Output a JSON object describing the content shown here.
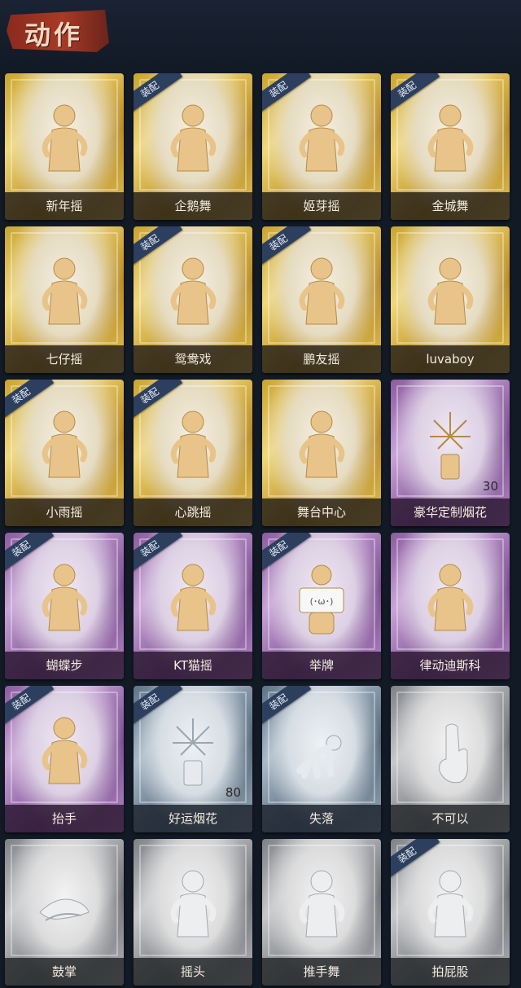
{
  "title": "动作",
  "equip_label": "装配",
  "cards": [
    {
      "name": "新年摇",
      "tier": "gold",
      "equipped": false,
      "count": "",
      "icon": "dancer-icon"
    },
    {
      "name": "企鹅舞",
      "tier": "gold",
      "equipped": true,
      "count": "",
      "icon": "dancer-icon"
    },
    {
      "name": "姬芽摇",
      "tier": "gold",
      "equipped": true,
      "count": "",
      "icon": "dancer-icon"
    },
    {
      "name": "金城舞",
      "tier": "gold",
      "equipped": true,
      "count": "",
      "icon": "dancer-icon"
    },
    {
      "name": "七仔摇",
      "tier": "gold",
      "equipped": false,
      "count": "",
      "icon": "dancer-icon"
    },
    {
      "name": "鸳鸯戏",
      "tier": "gold",
      "equipped": true,
      "count": "",
      "icon": "dancer-icon"
    },
    {
      "name": "鹏友摇",
      "tier": "gold",
      "equipped": true,
      "count": "",
      "icon": "dancer-icon"
    },
    {
      "name": "luvaboy",
      "tier": "gold",
      "equipped": false,
      "count": "",
      "icon": "dancer-icon"
    },
    {
      "name": "小雨摇",
      "tier": "gold",
      "equipped": true,
      "count": "",
      "icon": "dancer-icon"
    },
    {
      "name": "心跳摇",
      "tier": "gold",
      "equipped": true,
      "count": "",
      "icon": "dancer-icon"
    },
    {
      "name": "舞台中心",
      "tier": "gold",
      "equipped": false,
      "count": "",
      "icon": "dancer-icon"
    },
    {
      "name": "豪华定制烟花",
      "tier": "purple",
      "equipped": false,
      "count": "30",
      "icon": "firework-icon"
    },
    {
      "name": "蝴蝶步",
      "tier": "purple",
      "equipped": true,
      "count": "",
      "icon": "dancer-icon"
    },
    {
      "name": "KT猫摇",
      "tier": "purple",
      "equipped": true,
      "count": "",
      "icon": "dancer-icon"
    },
    {
      "name": "举牌",
      "tier": "purple",
      "equipped": true,
      "count": "",
      "icon": "sign-icon"
    },
    {
      "name": "律动迪斯科",
      "tier": "purple",
      "equipped": false,
      "count": "",
      "icon": "dancer-icon"
    },
    {
      "name": "抬手",
      "tier": "purple",
      "equipped": true,
      "count": "",
      "icon": "dancer-icon"
    },
    {
      "name": "好运烟花",
      "tier": "blue",
      "equipped": true,
      "count": "80",
      "icon": "firework-icon"
    },
    {
      "name": "失落",
      "tier": "blue",
      "equipped": true,
      "count": "",
      "icon": "crawl-icon"
    },
    {
      "name": "不可以",
      "tier": "gray",
      "equipped": false,
      "count": "",
      "icon": "hand-icon"
    },
    {
      "name": "鼓掌",
      "tier": "gray",
      "equipped": false,
      "count": "",
      "icon": "clap-icon"
    },
    {
      "name": "摇头",
      "tier": "gray",
      "equipped": false,
      "count": "",
      "icon": "dancer-icon"
    },
    {
      "name": "推手舞",
      "tier": "gray",
      "equipped": false,
      "count": "",
      "icon": "dancer-icon"
    },
    {
      "name": "拍屁股",
      "tier": "gray",
      "equipped": true,
      "count": "",
      "icon": "dancer-icon"
    }
  ]
}
